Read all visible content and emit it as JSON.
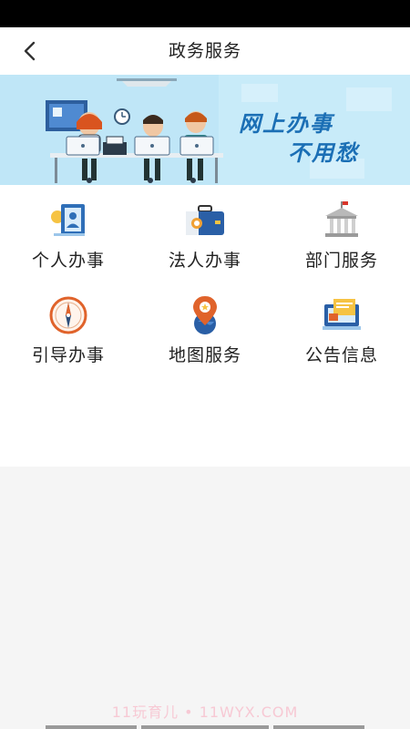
{
  "nav": {
    "title": "政务服务",
    "back_icon": "chevron-left-icon"
  },
  "banner": {
    "line1": "网上办事",
    "line2": "不用愁"
  },
  "services": [
    {
      "label": "个人办事",
      "icon": "person-card-icon"
    },
    {
      "label": "法人办事",
      "icon": "briefcase-icon"
    },
    {
      "label": "部门服务",
      "icon": "government-building-icon"
    },
    {
      "label": "引导办事",
      "icon": "compass-icon"
    },
    {
      "label": "地图服务",
      "icon": "map-pin-icon"
    },
    {
      "label": "公告信息",
      "icon": "notice-board-icon"
    }
  ],
  "watermark": "11玩育儿 • 11WYX.COM",
  "colors": {
    "banner_bg": "#bfe6f7",
    "banner_text": "#1b6fb5"
  }
}
